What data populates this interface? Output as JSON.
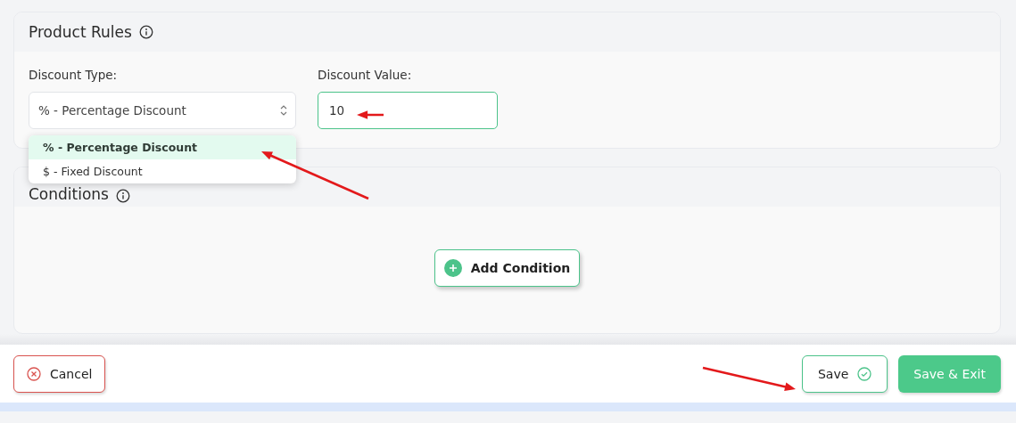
{
  "product_rules": {
    "title": "Product Rules",
    "discount_type": {
      "label": "Discount Type:",
      "value": "% - Percentage Discount",
      "expanded": true,
      "options": [
        {
          "label": "% - Percentage Discount",
          "selected": true
        },
        {
          "label": "$ - Fixed Discount",
          "selected": false
        }
      ]
    },
    "discount_value": {
      "label": "Discount Value:",
      "value": "10"
    }
  },
  "conditions": {
    "title": "Conditions",
    "add_button": "Add Condition"
  },
  "footer": {
    "cancel": "Cancel",
    "save": "Save",
    "save_exit": "Save & Exit"
  }
}
